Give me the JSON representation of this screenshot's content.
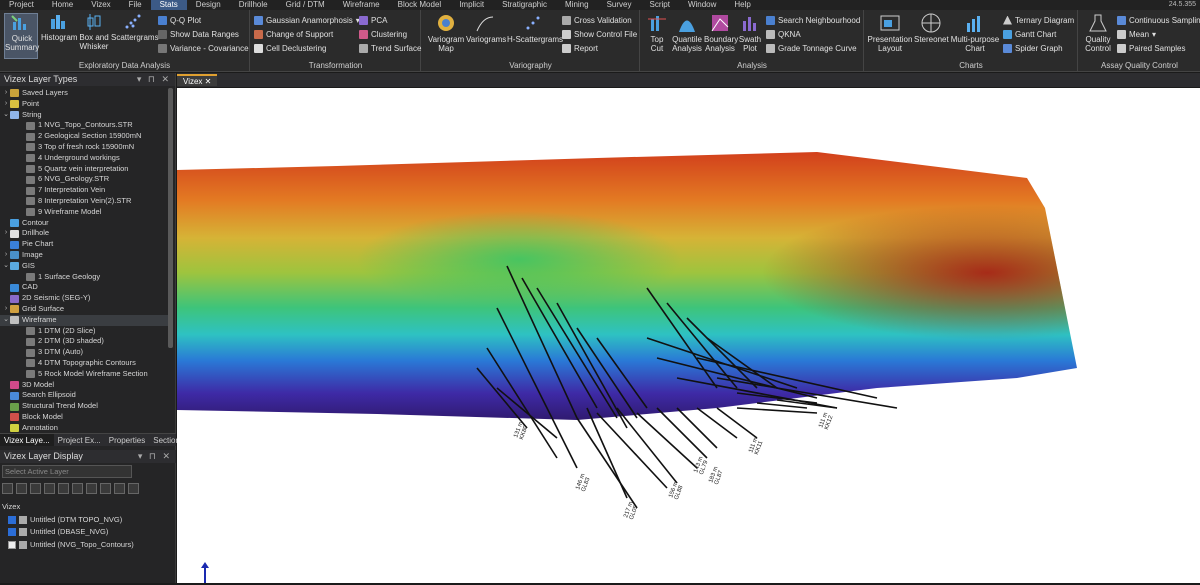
{
  "menu": [
    "Project",
    "Home",
    "Vizex",
    "File",
    "Stats",
    "Design",
    "Drillhole",
    "Grid / DTM",
    "Wireframe",
    "Block Model",
    "Implicit",
    "Stratigraphic",
    "Mining",
    "Survey",
    "Script",
    "Window",
    "Help"
  ],
  "menu_active": "Stats",
  "version": "24.5.355",
  "ribbon": {
    "eda": {
      "label": "Exploratory Data Analysis",
      "quick": "Quick Summary",
      "histogram": "Histogram",
      "box": "Box and Whisker",
      "scatter": "Scattergrams",
      "qq": "Q-Q Plot",
      "showranges": "Show Data Ranges",
      "varcov": "Variance - Covariance"
    },
    "transformation": {
      "label": "Transformation",
      "gauss": "Gaussian Anamorphosis",
      "pca": "PCA",
      "support": "Change of Support",
      "clustering": "Clustering",
      "decluster": "Cell Declustering",
      "trend": "Trend Surface"
    },
    "variography": {
      "label": "Variography",
      "map": "Variogram Map",
      "variograms": "Variograms",
      "hscatter": "H-Scattergrams",
      "crossval": "Cross Validation",
      "showctl": "Show Control File",
      "report": "Report"
    },
    "analysis": {
      "label": "Analysis",
      "topcut": "Top Cut",
      "quantile": "Quantile Analysis",
      "boundary": "Boundary Analysis",
      "swath": "Swath Plot",
      "searchnb": "Search Neighbourhood",
      "qkna": "QKNA",
      "gradet": "Grade Tonnage Curve"
    },
    "charts": {
      "label": "Charts",
      "presentation": "Presentation Layout",
      "stereonet": "Stereonet",
      "multipurpose": "Multi-purpose Chart",
      "ternary": "Ternary Diagram",
      "gantt": "Gantt Chart",
      "spider": "Spider Graph"
    },
    "assay": {
      "label": "Assay Quality Control",
      "quality": "Quality Control",
      "contsamp": "Continuous Sampling",
      "mean": "Mean",
      "paired": "Paired Samples"
    }
  },
  "layer_types_title": "Vizex Layer Types",
  "tree": [
    {
      "label": "Saved Layers",
      "lvl": 0,
      "arrow": "›",
      "color": "#c9a23a"
    },
    {
      "label": "Point",
      "lvl": 0,
      "arrow": "›",
      "color": "#d9c040"
    },
    {
      "label": "String",
      "lvl": 0,
      "arrow": "⌄",
      "color": "#8fb4e8"
    },
    {
      "label": "1 NVG_Topo_Contours.STR",
      "lvl": 1,
      "arrow": "",
      "color": "#7a7a7a"
    },
    {
      "label": "2 Geological Section 15900mN",
      "lvl": 1,
      "arrow": "",
      "color": "#7a7a7a"
    },
    {
      "label": "3 Top of fresh rock 15900mN",
      "lvl": 1,
      "arrow": "",
      "color": "#7a7a7a"
    },
    {
      "label": "4 Underground workings",
      "lvl": 1,
      "arrow": "",
      "color": "#7a7a7a"
    },
    {
      "label": "5 Quartz vein interpretation",
      "lvl": 1,
      "arrow": "",
      "color": "#7a7a7a"
    },
    {
      "label": "6 NVG_Geology.STR",
      "lvl": 1,
      "arrow": "",
      "color": "#7a7a7a"
    },
    {
      "label": "7 Interpretation Vein",
      "lvl": 1,
      "arrow": "",
      "color": "#7a7a7a"
    },
    {
      "label": "8 Interpretation Vein(2).STR",
      "lvl": 1,
      "arrow": "",
      "color": "#7a7a7a"
    },
    {
      "label": "9 Wireframe Model",
      "lvl": 1,
      "arrow": "",
      "color": "#7a7a7a"
    },
    {
      "label": "Contour",
      "lvl": 0,
      "arrow": "",
      "color": "#4aa0e0"
    },
    {
      "label": "Drillhole",
      "lvl": 0,
      "arrow": "›",
      "color": "#e0e0e0"
    },
    {
      "label": "Pie Chart",
      "lvl": 0,
      "arrow": "",
      "color": "#3a7fd8"
    },
    {
      "label": "Image",
      "lvl": 0,
      "arrow": "›",
      "color": "#4a90c8"
    },
    {
      "label": "GIS",
      "lvl": 0,
      "arrow": "⌄",
      "color": "#5aaae0"
    },
    {
      "label": "1 Surface Geology",
      "lvl": 1,
      "arrow": "",
      "color": "#7a7a7a"
    },
    {
      "label": "CAD",
      "lvl": 0,
      "arrow": "",
      "color": "#3a8ad8"
    },
    {
      "label": "2D Seismic (SEG-Y)",
      "lvl": 0,
      "arrow": "",
      "color": "#8a6ac8"
    },
    {
      "label": "Grid Surface",
      "lvl": 0,
      "arrow": "›",
      "color": "#d0a040"
    },
    {
      "label": "Wireframe",
      "lvl": 0,
      "arrow": "⌄",
      "color": "#c0c0c0",
      "sel": true
    },
    {
      "label": "1 DTM (2D Slice)",
      "lvl": 1,
      "arrow": "",
      "color": "#7a7a7a"
    },
    {
      "label": "2 DTM (3D shaded)",
      "lvl": 1,
      "arrow": "",
      "color": "#7a7a7a"
    },
    {
      "label": "3 DTM (Auto)",
      "lvl": 1,
      "arrow": "",
      "color": "#7a7a7a"
    },
    {
      "label": "4 DTM Topographic Contours",
      "lvl": 1,
      "arrow": "",
      "color": "#7a7a7a"
    },
    {
      "label": "5 Rock Model Wireframe Section",
      "lvl": 1,
      "arrow": "",
      "color": "#7a7a7a"
    },
    {
      "label": "3D Model",
      "lvl": 0,
      "arrow": "",
      "color": "#d04a8a"
    },
    {
      "label": "Search Ellipsoid",
      "lvl": 0,
      "arrow": "",
      "color": "#4a8ad8"
    },
    {
      "label": "Structural Trend Model",
      "lvl": 0,
      "arrow": "",
      "color": "#6aa04a"
    },
    {
      "label": "Block Model",
      "lvl": 0,
      "arrow": "",
      "color": "#d0504a"
    },
    {
      "label": "Annotation",
      "lvl": 0,
      "arrow": "",
      "color": "#d0d040"
    }
  ],
  "left_tabs": [
    "Vizex Laye...",
    "Project Ex...",
    "Properties",
    "Sections"
  ],
  "display_title": "Vizex Layer Display",
  "display_placeholder": "Select Active Layer",
  "display_root": "Vizex",
  "display_layers": [
    {
      "label": "Untitled (DTM TOPO_NVG)",
      "checked": true
    },
    {
      "label": "Untitled (DBASE_NVG)",
      "checked": true
    },
    {
      "label": "Untitled (NVG_Topo_Contours)",
      "checked": false
    }
  ],
  "view_tab": "Vizex",
  "drill_labels": [
    {
      "t": "131 m",
      "t2": "KK80"
    },
    {
      "t": "146 m",
      "t2": "GL83"
    },
    {
      "t": "217 m",
      "t2": "GL05"
    },
    {
      "t": "156 m",
      "t2": "GL88"
    },
    {
      "t": "111 m",
      "t2": "KK11"
    },
    {
      "t": "111 m",
      "t2": "KK12"
    },
    {
      "t": "143 m",
      "t2": "GL79"
    },
    {
      "t": "183 m",
      "t2": "GL87"
    }
  ]
}
